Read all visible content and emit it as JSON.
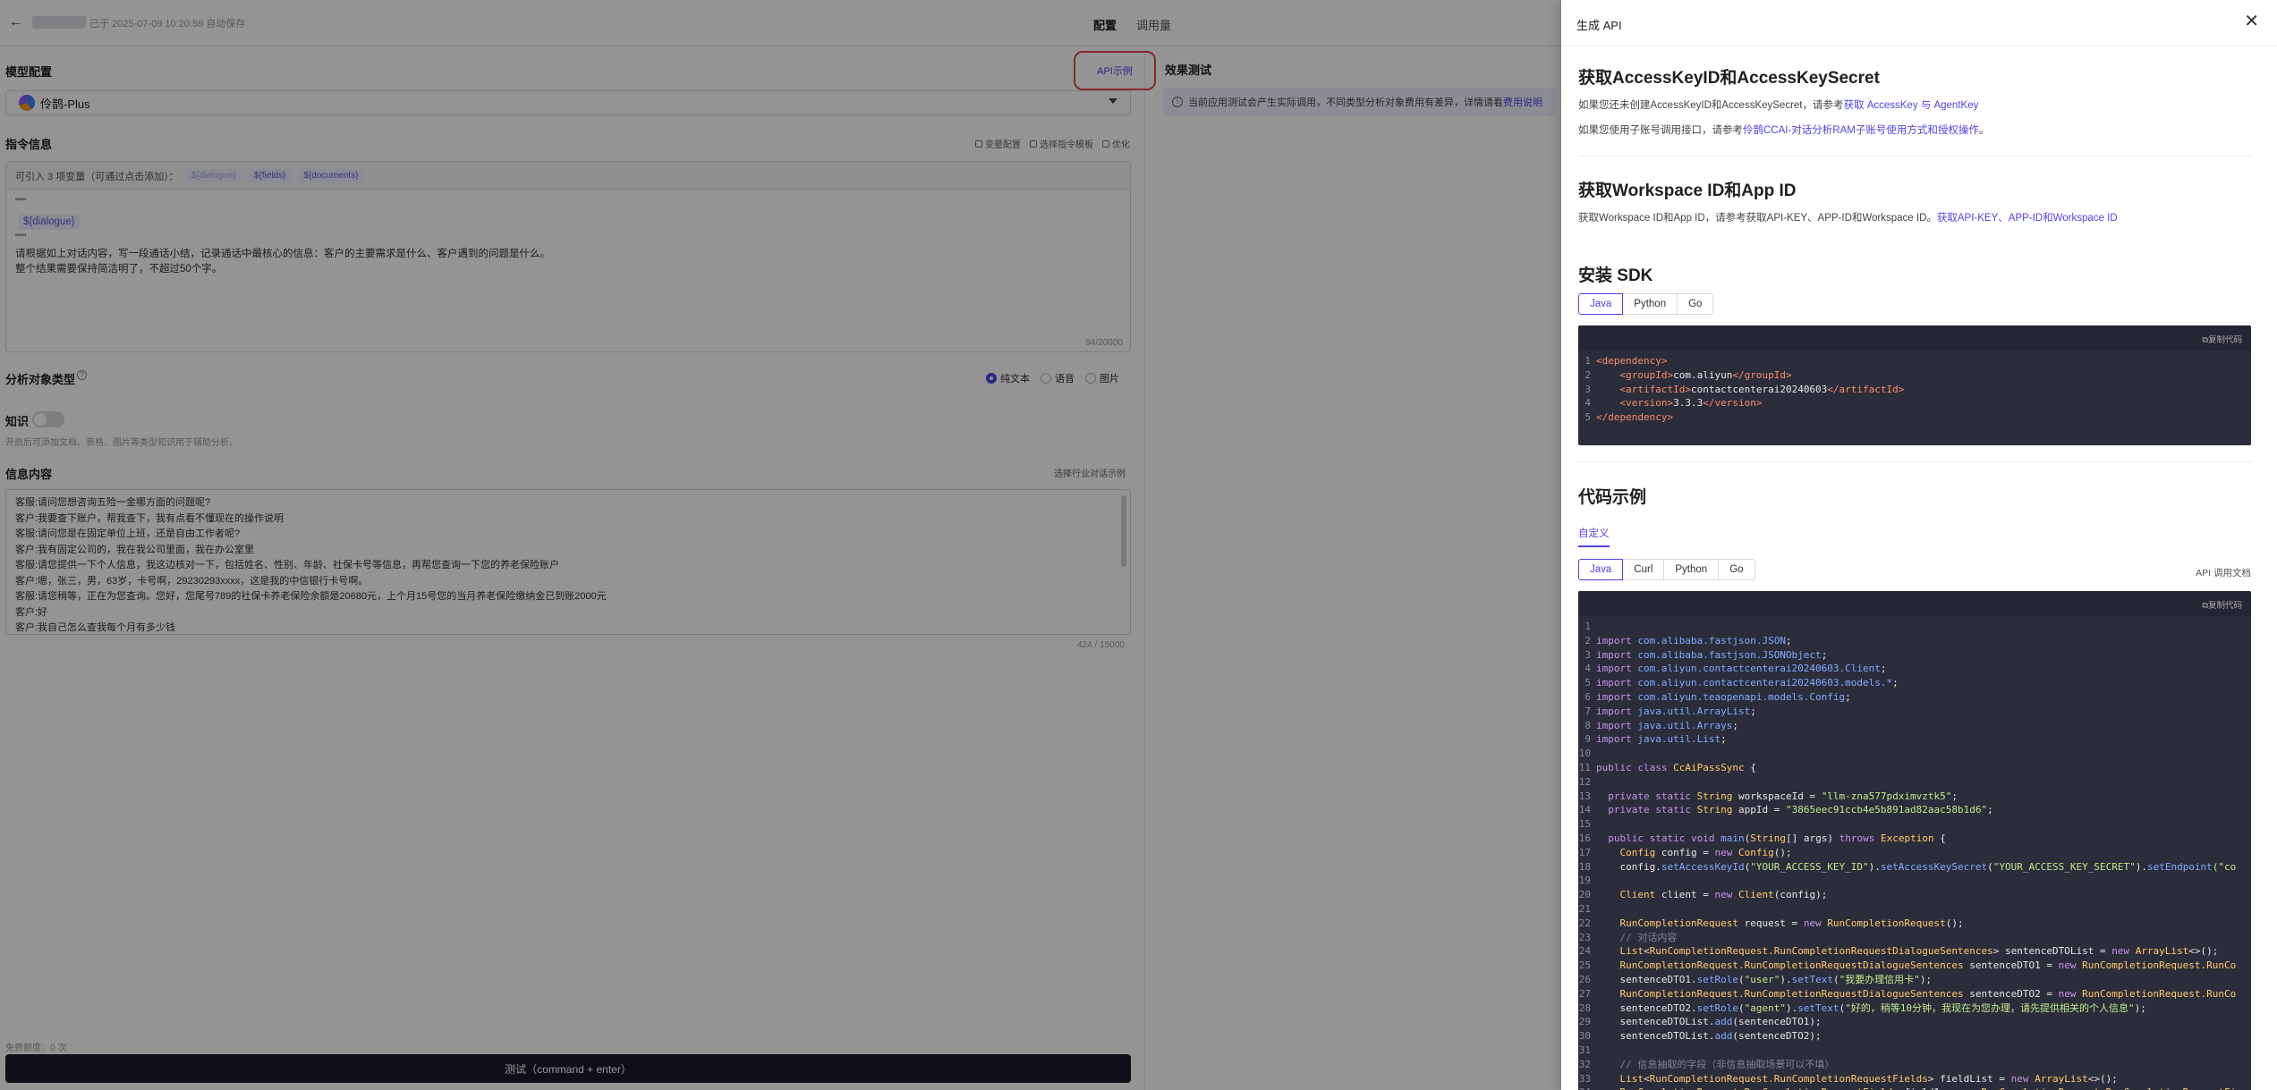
{
  "header": {
    "save_info": "已于 2025-07-09 10:20:59 自动保存",
    "tabs": [
      "配置",
      "调用量"
    ]
  },
  "model_config": {
    "title": "模型配置",
    "api_example_link": "API示例",
    "model_name": "伶鹊-Plus"
  },
  "instruction": {
    "title": "指令信息",
    "tools": [
      "变量配置",
      "选择指令模板",
      "优化"
    ],
    "var_intro": "可引入 3 项变量（可通过点击添加）：",
    "vars": [
      "${dialogue}",
      "${fields}",
      "${documents}"
    ],
    "fence": "\"\"\"",
    "dialogue_var": "${dialogue}",
    "line1": "请根据如上对话内容，写一段通话小结，记录通话中最核心的信息：客户的主要需求是什么、客户遇到的问题是什么。",
    "line2": "整个结果需要保持简洁明了，不超过50个字。",
    "counter": "94/20000"
  },
  "analysis_type": {
    "title": "分析对象类型",
    "options": [
      "纯文本",
      "语音",
      "图片"
    ],
    "selected": "纯文本"
  },
  "knowledge": {
    "title": "知识",
    "hint": "开启后可添加文档、表格、图片等类型知识用于辅助分析。"
  },
  "info_content": {
    "title": "信息内容",
    "select_example": "选择行业对话示例",
    "lines": [
      "客服:请问您想咨询五险一金哪方面的问题呢?",
      "客户:我要查下账户，帮我查下，我有点看不懂现在的操作说明",
      "客服:请问您是在固定单位上班，还是自由工作者呢?",
      "客户:我有固定公司的，我在我公司里面，我在办公室里",
      "客服:请您提供一下个人信息，我这边核对一下，包括姓名、性别、年龄、社保卡号等信息，再帮您查询一下您的养老保险账户",
      "客户:嗯，张三，男，63岁，卡号啊，29230293xxxx，这是我的中信银行卡号啊。",
      "客服:请您稍等，正在为您查询。您好，您尾号789的社保卡养老保险余额是20680元，上个月15号您的当月养老保险缴纳金已到账2000元",
      "客户:好",
      "客户:我自己怎么查我每个月有多少钱"
    ],
    "counter": "424 / 15000"
  },
  "free_quota": "免费额度：0 次",
  "test_button": "测试（command + enter）",
  "effect_test": {
    "title": "效果测试",
    "notice": "当前应用测试会产生实际调用，不同类型分析对象费用有差异，详情请看",
    "notice_link": "费用说明"
  },
  "drawer": {
    "title": "生成 API",
    "sec1": {
      "title": "获取AccessKeyID和AccessKeySecret",
      "p1_text": "如果您还未创建AccessKeyID和AccessKeySecret，请参考",
      "p1_link": "获取 AccessKey 与 AgentKey",
      "p2_text": "如果您使用子账号调用接口，请参考",
      "p2_link": "伶鹊CCAI-对话分析RAM子账号使用方式和授权操作",
      "p2_end": "。"
    },
    "sec2": {
      "title": "获取Workspace ID和App ID",
      "p_text": "获取Workspace ID和App ID，请参考获取API-KEY、APP-ID和Workspace ID。",
      "p_link": "获取API-KEY、APP-ID和Workspace ID"
    },
    "sec3": {
      "title": "安装 SDK",
      "tabs": [
        "Java",
        "Python",
        "Go"
      ],
      "copy": "复制代码",
      "group_id": "com.aliyun",
      "artifact_id": "contactcenterai20240603",
      "version": "3.3.3"
    },
    "sec4": {
      "title": "代码示例",
      "sub_tab": "自定义",
      "tabs": [
        "Java",
        "Curl",
        "Python",
        "Go"
      ],
      "api_doc": "API 调用文档",
      "copy": "复制代码",
      "imports": [
        "com.alibaba.fastjson.JSON",
        "com.alibaba.fastjson.JSONObject",
        "com.aliyun.contactcenterai20240603.Client",
        "com.aliyun.contactcenterai20240603.models.*",
        "com.aliyun.teaopenapi.models.Config",
        "java.util.ArrayList",
        "java.util.Arrays",
        "java.util.List"
      ],
      "class_name": "CcAiPassSync",
      "workspace_id": "\"llm-zna577pdximvztk5\"",
      "app_id": "\"3865eec91ccb4e5b891ad82aac58b1d6\"",
      "access_key_id": "\"YOUR_ACCESS_KEY_ID\"",
      "access_key_secret": "\"YOUR_ACCESS_KEY_SECRET\"",
      "endpoint_partial": "(\"co",
      "comment_dialogue": "// 对话内容",
      "user_text": "\"我要办理信用卡\"",
      "agent_text": "\"好的，稍等10分钟，我现在为您办理，请先提供相关的个人信息\"",
      "comment_fields": "// 信息抽取的字段（非信息抽取场景可以不填）",
      "role_user": "\"user\"",
      "role_agent": "\"agent\""
    }
  }
}
